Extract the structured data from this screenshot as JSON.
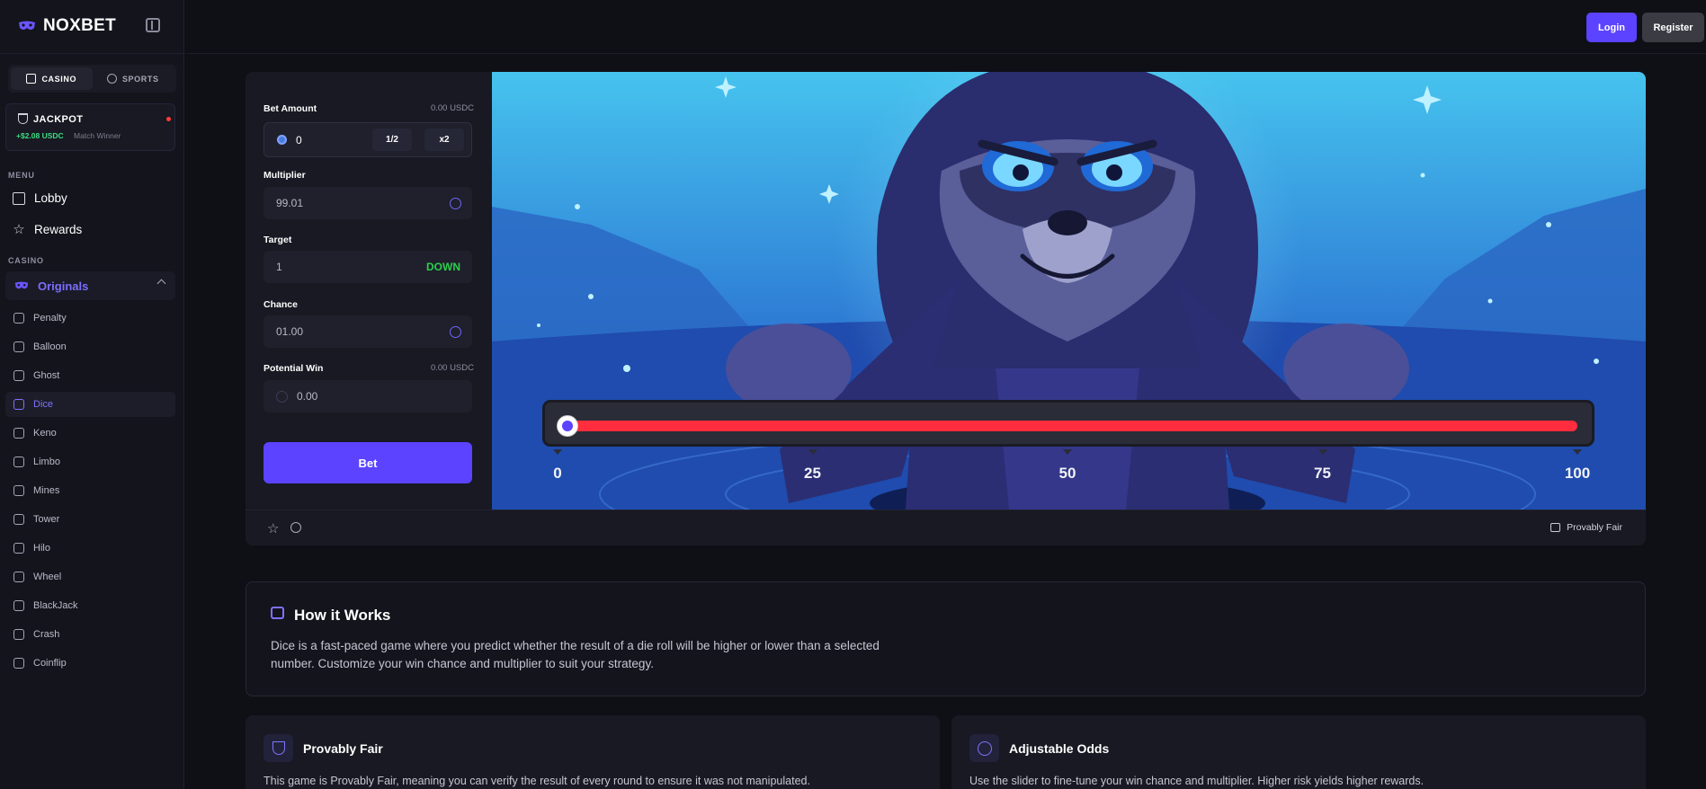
{
  "brand": {
    "name": "NOXBET",
    "accent": "#5b43ff"
  },
  "sidebar": {
    "tabs": [
      {
        "label": "CASINO",
        "icon": "casino-icon",
        "active": true
      },
      {
        "label": "SPORTS",
        "icon": "sports-ball-icon",
        "active": false
      }
    ],
    "jackpot": {
      "title": "JACKPOT",
      "amount": "+$2.08 USDC",
      "subtitle": "Match Winner"
    },
    "menu_label": "MENU",
    "menu": [
      {
        "label": "Lobby",
        "icon": "home-icon"
      },
      {
        "label": "Rewards",
        "icon": "star-icon"
      }
    ],
    "casino_label": "CASINO",
    "group": {
      "label": "Originals",
      "icon": "mask-icon"
    },
    "games": [
      {
        "label": "Penalty",
        "icon": "penalty-icon"
      },
      {
        "label": "Balloon",
        "icon": "balloon-icon"
      },
      {
        "label": "Ghost",
        "icon": "ghost-icon"
      },
      {
        "label": "Dice",
        "icon": "dice-icon",
        "active": true
      },
      {
        "label": "Keno",
        "icon": "gem-icon"
      },
      {
        "label": "Limbo",
        "icon": "limbo-icon"
      },
      {
        "label": "Mines",
        "icon": "mines-icon"
      },
      {
        "label": "Tower",
        "icon": "tower-icon"
      },
      {
        "label": "Hilo",
        "icon": "cards-icon"
      },
      {
        "label": "Wheel",
        "icon": "wheel-icon"
      },
      {
        "label": "BlackJack",
        "icon": "blackjack-icon"
      },
      {
        "label": "Crash",
        "icon": "rocket-icon"
      },
      {
        "label": "Coinflip",
        "icon": "coin-icon"
      }
    ]
  },
  "header": {
    "login": "Login",
    "register": "Register"
  },
  "controls": {
    "bet_amount_label": "Bet Amount",
    "bet_amount_balance": "0.00 USDC",
    "bet_amount_value": "0",
    "half_label": "1/2",
    "double_label": "x2",
    "multiplier_label": "Multiplier",
    "multiplier_value": "99.01",
    "target_label": "Target",
    "target_value": "1",
    "target_direction": "DOWN",
    "chance_label": "Chance",
    "chance_value": "01.00",
    "potential_win_label": "Potential Win",
    "potential_win_balance": "0.00 USDC",
    "potential_win_value": "0.00",
    "bet_button": "Bet"
  },
  "slider": {
    "value": 1,
    "min": 0,
    "max": 100,
    "ticks": [
      "0",
      "25",
      "50",
      "75",
      "100"
    ],
    "track_color": "#ff2d3d"
  },
  "game_footer": {
    "provably_fair": "Provably Fair"
  },
  "how": {
    "title": "How it Works",
    "text": "Dice is a fast-paced game where you predict whether the result of a die roll will be higher or lower than a selected number. Customize your win chance and multiplier to suit your strategy."
  },
  "features": [
    {
      "title": "Provably Fair",
      "text": "This game is Provably Fair, meaning you can verify the result of every round to ensure it was not manipulated.",
      "icon": "shield-icon"
    },
    {
      "title": "Adjustable Odds",
      "text": "Use the slider to fine-tune your win chance and multiplier. Higher risk yields higher rewards.",
      "icon": "hexagon-icon"
    }
  ]
}
